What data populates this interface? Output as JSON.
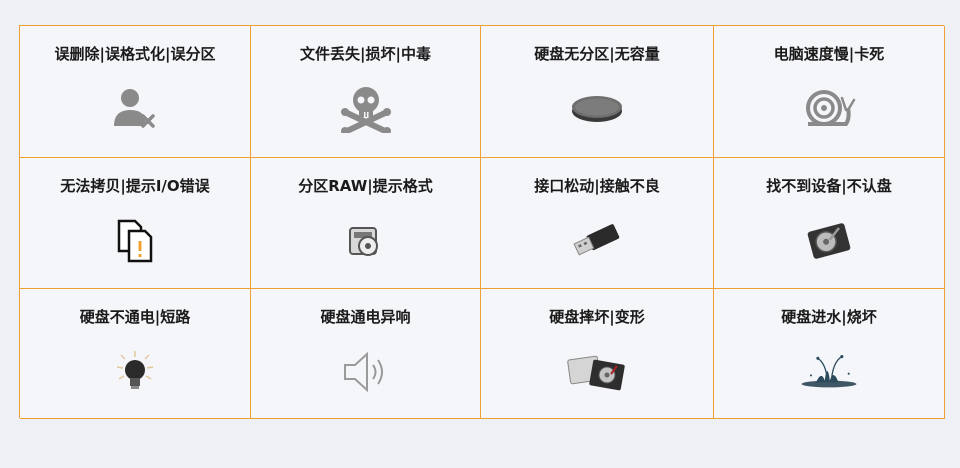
{
  "cells": [
    {
      "label": "误删除|误格式化|误分区",
      "icon": "user-delete-icon"
    },
    {
      "label": "文件丢失|损坏|中毒",
      "icon": "skull-crossbones-icon"
    },
    {
      "label": "硬盘无分区|无容量",
      "icon": "disk-platter-icon"
    },
    {
      "label": "电脑速度慢|卡死",
      "icon": "snail-icon"
    },
    {
      "label": "无法拷贝|提示I/O错误",
      "icon": "copy-warning-icon"
    },
    {
      "label": "分区RAW|提示格式",
      "icon": "disk-drive-icon"
    },
    {
      "label": "接口松动|接触不良",
      "icon": "usb-drive-icon"
    },
    {
      "label": "找不到设备|不认盘",
      "icon": "hard-drive-icon"
    },
    {
      "label": "硬盘不通电|短路",
      "icon": "light-bulb-icon"
    },
    {
      "label": "硬盘通电异响",
      "icon": "speaker-sound-icon"
    },
    {
      "label": "硬盘摔坏|变形",
      "icon": "broken-hard-drive-icon"
    },
    {
      "label": "硬盘进水|烧坏",
      "icon": "water-splash-icon"
    }
  ],
  "colors": {
    "border": "#f0a030",
    "background": "#eef0f6",
    "icon_gray": "#8a8a8a"
  }
}
